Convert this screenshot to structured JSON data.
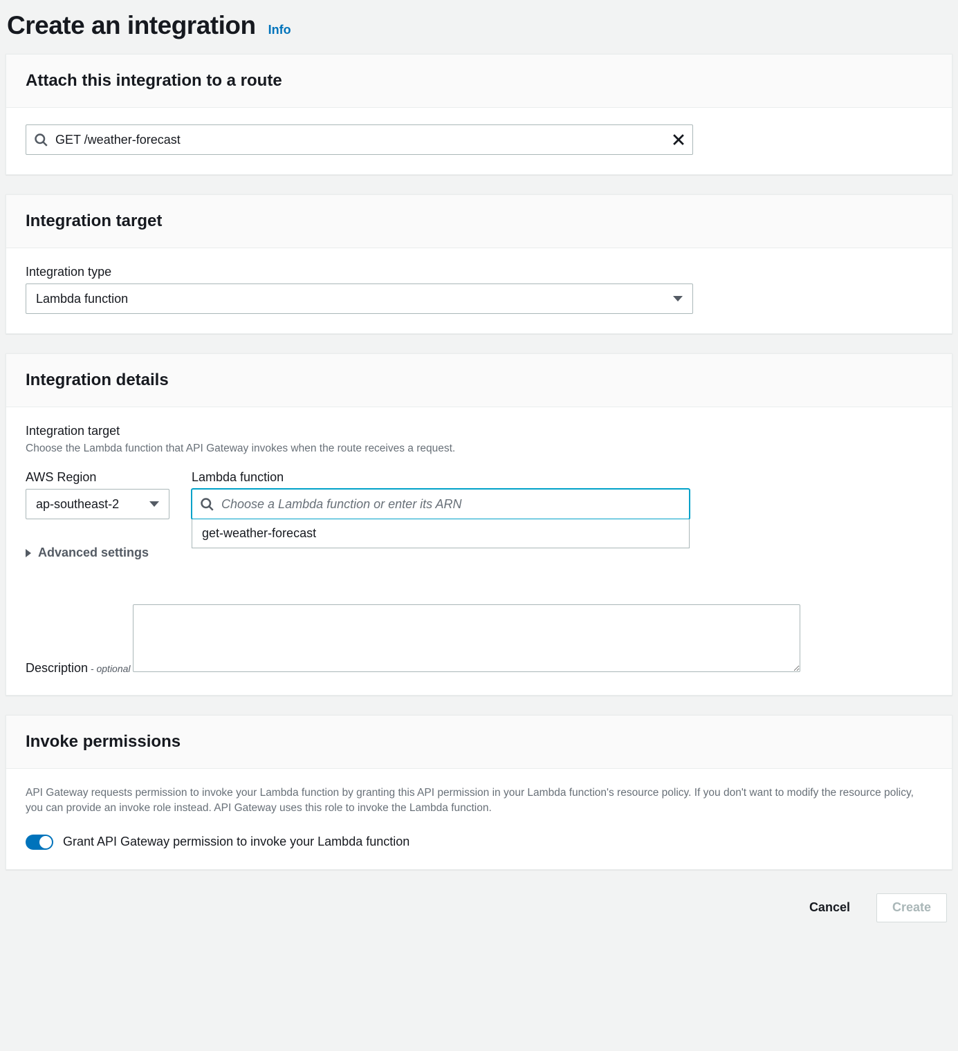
{
  "header": {
    "title": "Create an integration",
    "info_link": "Info"
  },
  "attach": {
    "heading": "Attach this integration to a route",
    "route_value": "GET /weather-forecast"
  },
  "target": {
    "heading": "Integration target",
    "type_label": "Integration type",
    "type_value": "Lambda function"
  },
  "details": {
    "heading": "Integration details",
    "target_label": "Integration target",
    "target_hint": "Choose the Lambda function that API Gateway invokes when the route receives a request.",
    "region_label": "AWS Region",
    "region_value": "ap-southeast-2",
    "lambda_label": "Lambda function",
    "lambda_placeholder": "Choose a Lambda function or enter its ARN",
    "lambda_value": "",
    "lambda_options": [
      "get-weather-forecast"
    ],
    "advanced_label": "Advanced settings",
    "description_label": "Description",
    "description_optional": " - optional",
    "description_value": ""
  },
  "permissions": {
    "heading": "Invoke permissions",
    "text": "API Gateway requests permission to invoke your Lambda function by granting this API permission in your Lambda function's resource policy. If you don't want to modify the resource policy, you can provide an invoke role instead. API Gateway uses this role to invoke the Lambda function.",
    "toggle_label": "Grant API Gateway permission to invoke your Lambda function",
    "toggle_on": true
  },
  "footer": {
    "cancel": "Cancel",
    "create": "Create"
  }
}
